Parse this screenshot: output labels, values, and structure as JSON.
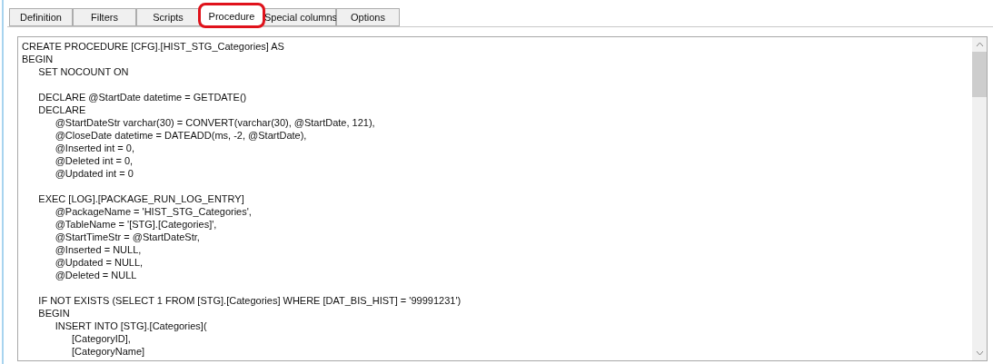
{
  "tabs": [
    {
      "label": "Definition",
      "selected": false,
      "highlighted": false
    },
    {
      "label": "Filters",
      "selected": false,
      "highlighted": false
    },
    {
      "label": "Scripts",
      "selected": false,
      "highlighted": false
    },
    {
      "label": "Procedure",
      "selected": true,
      "highlighted": true
    },
    {
      "label": "Special columns",
      "selected": false,
      "highlighted": false
    },
    {
      "label": "Options",
      "selected": false,
      "highlighted": false
    }
  ],
  "editor": {
    "blocks": [
      [
        "CREATE PROCEDURE [CFG].[HIST_STG_Categories] AS",
        "BEGIN",
        "\tSET NOCOUNT ON"
      ],
      [
        "\tDECLARE @StartDate datetime = GETDATE()",
        "\tDECLARE",
        "\t\t@StartDateStr varchar(30) = CONVERT(varchar(30), @StartDate, 121),",
        "\t\t@CloseDate datetime = DATEADD(ms, -2, @StartDate),",
        "\t\t@Inserted int = 0,",
        "\t\t@Deleted int = 0,",
        "\t\t@Updated int = 0"
      ],
      [
        "\tEXEC [LOG].[PACKAGE_RUN_LOG_ENTRY]",
        "\t\t@PackageName = 'HIST_STG_Categories',",
        "\t\t@TableName = '[STG].[Categories]',",
        "\t\t@StartTimeStr = @StartDateStr,",
        "\t\t@Inserted = NULL,",
        "\t\t@Updated = NULL,",
        "\t\t@Deleted = NULL"
      ],
      [
        "\tIF NOT EXISTS (SELECT 1 FROM [STG].[Categories] WHERE [DAT_BIS_HIST] = '99991231')",
        "\tBEGIN",
        "\t\tINSERT INTO [STG].[Categories](",
        "\t\t\t[CategoryID],",
        "\t\t\t[CategoryName]"
      ]
    ]
  }
}
